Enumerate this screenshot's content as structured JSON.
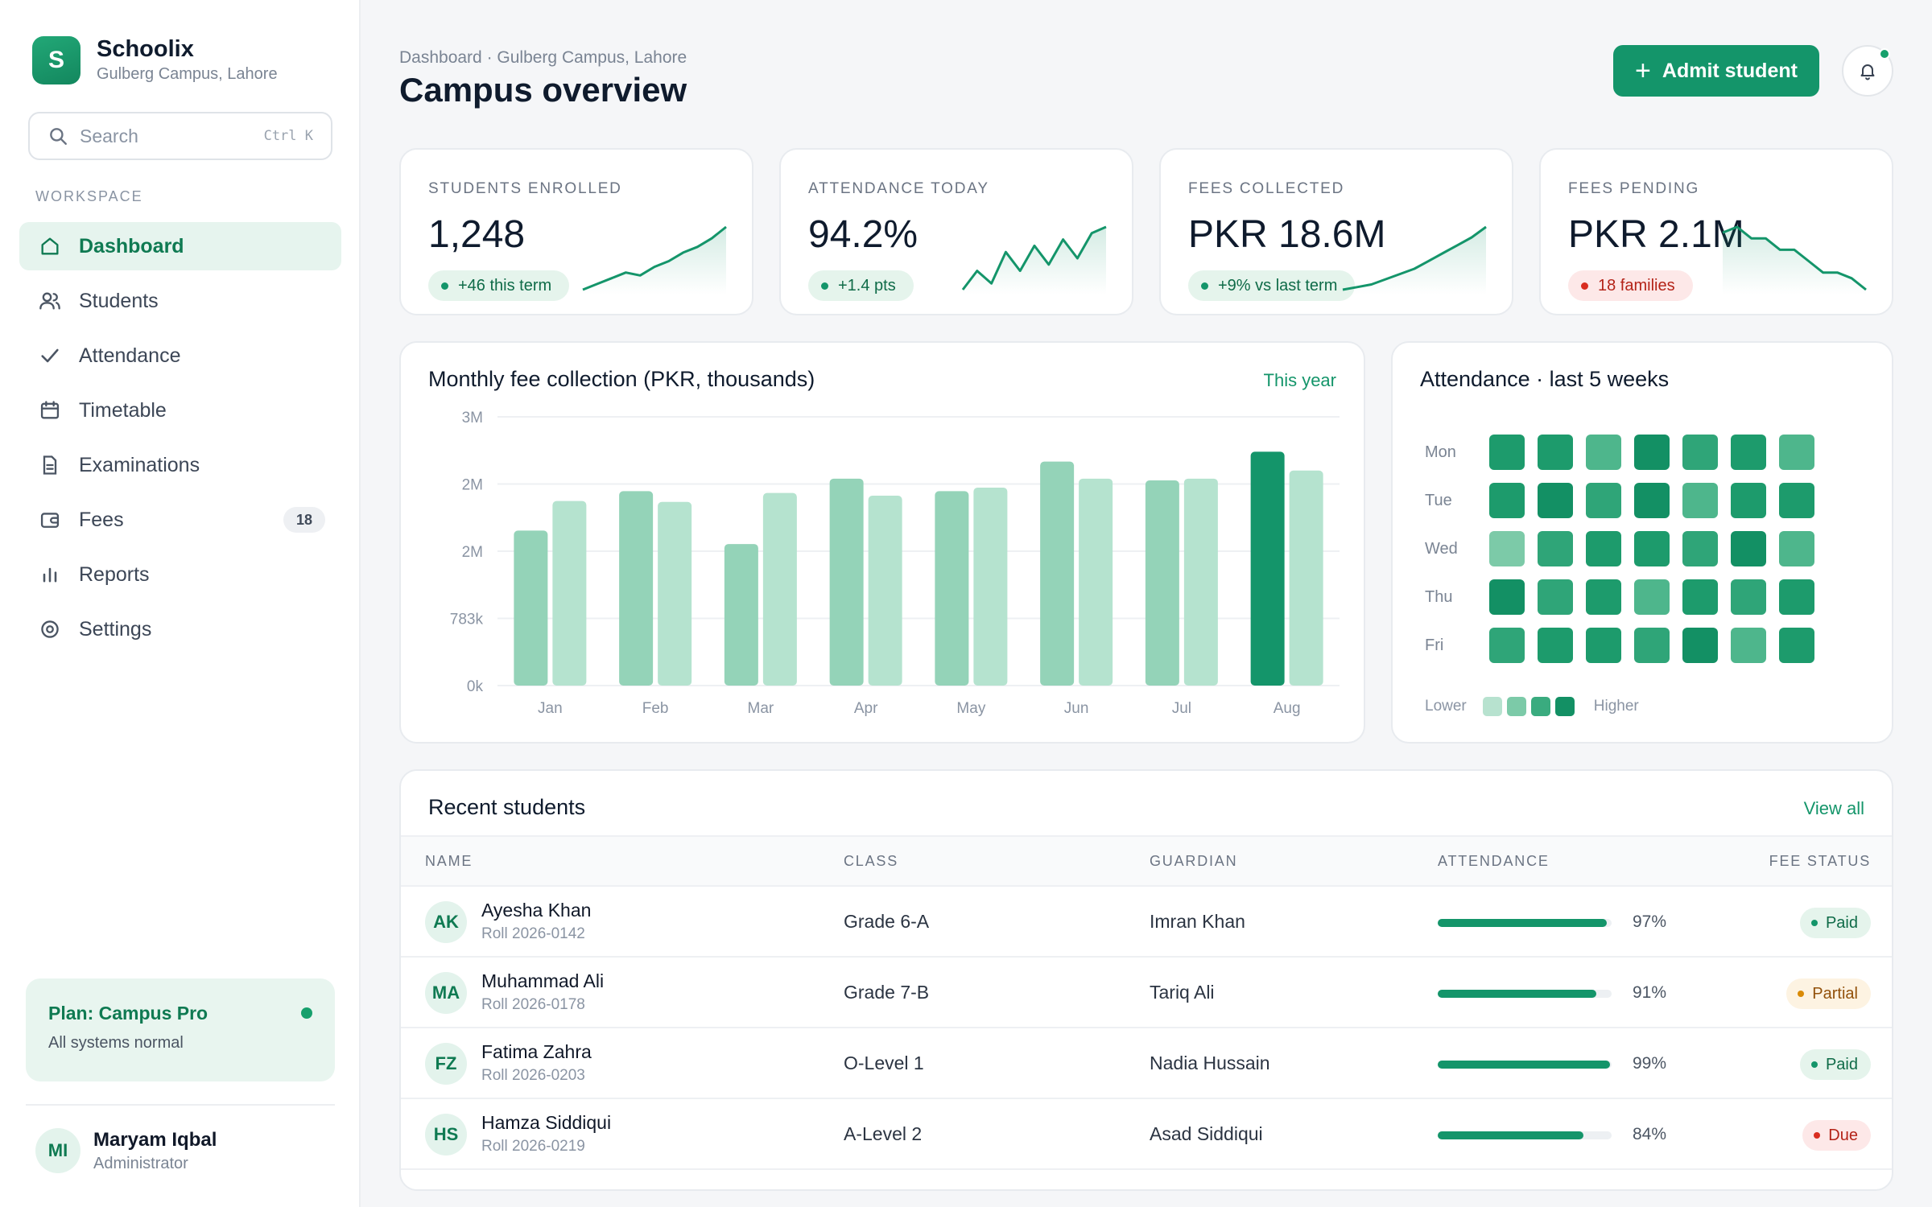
{
  "app": {
    "name": "Schoolix",
    "campus": "Gulberg Campus, Lahore",
    "logo_letter": "S"
  },
  "search": {
    "placeholder": "Search",
    "shortcut": "Ctrl K"
  },
  "sidebar": {
    "section_label": "WORKSPACE",
    "items": [
      {
        "label": "Dashboard",
        "icon": "home-icon",
        "active": true
      },
      {
        "label": "Students",
        "icon": "users-icon"
      },
      {
        "label": "Attendance",
        "icon": "check-icon"
      },
      {
        "label": "Timetable",
        "icon": "calendar-icon"
      },
      {
        "label": "Examinations",
        "icon": "document-icon"
      },
      {
        "label": "Fees",
        "icon": "wallet-icon",
        "badge": "18"
      },
      {
        "label": "Reports",
        "icon": "bar-chart-icon"
      },
      {
        "label": "Settings",
        "icon": "gear-icon"
      }
    ],
    "plan": {
      "title": "Plan: Campus Pro",
      "status": "All systems normal"
    },
    "user": {
      "initials": "MI",
      "name": "Maryam Iqbal",
      "role": "Administrator"
    }
  },
  "header": {
    "breadcrumb": "Dashboard · Gulberg Campus, Lahore",
    "title": "Campus overview",
    "admit_label": "Admit student"
  },
  "kpis": [
    {
      "label": "STUDENTS ENROLLED",
      "value": "1,248",
      "delta": "+46 this term",
      "tone": "good",
      "trend": [
        2,
        3,
        4,
        5,
        4.5,
        6,
        7,
        8.5,
        9.5,
        11,
        13
      ]
    },
    {
      "label": "ATTENDANCE TODAY",
      "value": "94.2%",
      "delta": "+1.4 pts",
      "tone": "good",
      "trend": [
        3,
        6,
        4,
        9,
        6,
        10,
        7,
        11,
        8,
        12,
        13
      ]
    },
    {
      "label": "FEES COLLECTED",
      "value": "PKR 18.6M",
      "delta": "+9% vs last term",
      "tone": "good",
      "trend": [
        1,
        1.5,
        2,
        3,
        4,
        5,
        6.5,
        8,
        9.5,
        11,
        13
      ]
    },
    {
      "label": "FEES PENDING",
      "value": "PKR 2.1M",
      "delta": "18 families",
      "tone": "bad",
      "trend": [
        12,
        13,
        11,
        11,
        9,
        9,
        7,
        5,
        5,
        4,
        2
      ]
    }
  ],
  "colors": {
    "accent": "#14956a",
    "accent_light": "#e6f4ee",
    "danger": "#d92d20",
    "warning": "#d98a06"
  },
  "chart_data": {
    "type": "bar",
    "title": "Monthly fee collection (PKR, thousands)",
    "period_link": "This year",
    "categories": [
      "Jan",
      "Feb",
      "Mar",
      "Apr",
      "May",
      "Jun",
      "Jul",
      "Aug"
    ],
    "yticks": [
      "0k",
      "783k",
      "2M",
      "2M",
      "3M"
    ],
    "ylim": [
      0,
      3000
    ],
    "series": [
      {
        "values": [
          1730,
          2170,
          1580,
          2310,
          2170,
          2500,
          2290,
          2610
        ]
      },
      {
        "values": [
          2060,
          2050,
          2150,
          2120,
          2210,
          2310,
          2310,
          2400
        ]
      }
    ],
    "highlight_index": 7,
    "grid": true
  },
  "heatmap": {
    "title": "Attendance · last 5 weeks",
    "days": [
      "Mon",
      "Tue",
      "Wed",
      "Thu",
      "Fri"
    ],
    "levels": [
      [
        3,
        3,
        1,
        4,
        2,
        3,
        1
      ],
      [
        3,
        4,
        2,
        4,
        1,
        3,
        3
      ],
      [
        0,
        2,
        3,
        3,
        2,
        4,
        1
      ],
      [
        4,
        2,
        3,
        1,
        3,
        2,
        3
      ],
      [
        2,
        3,
        3,
        2,
        4,
        1,
        3
      ]
    ],
    "level_colors": [
      "#7ccaa8",
      "#4eb68c",
      "#2fa578",
      "#1d9b6c",
      "#139064"
    ],
    "legend_low": "Lower",
    "legend_high": "Higher"
  },
  "students": {
    "title": "Recent students",
    "view_all": "View all",
    "columns": [
      "NAME",
      "CLASS",
      "GUARDIAN",
      "ATTENDANCE",
      "FEE STATUS"
    ],
    "rows": [
      {
        "initials": "AK",
        "name": "Ayesha Khan",
        "roll": "Roll 2026-0142",
        "class": "Grade 6-A",
        "guardian": "Imran Khan",
        "attendance": 97,
        "attendance_label": "97%",
        "fee_status": "Paid",
        "fee_tone": "paid"
      },
      {
        "initials": "MA",
        "name": "Muhammad Ali",
        "roll": "Roll 2026-0178",
        "class": "Grade 7-B",
        "guardian": "Tariq Ali",
        "attendance": 91,
        "attendance_label": "91%",
        "fee_status": "Partial",
        "fee_tone": "partial"
      },
      {
        "initials": "FZ",
        "name": "Fatima Zahra",
        "roll": "Roll 2026-0203",
        "class": "O-Level 1",
        "guardian": "Nadia Hussain",
        "attendance": 99,
        "attendance_label": "99%",
        "fee_status": "Paid",
        "fee_tone": "paid"
      },
      {
        "initials": "HS",
        "name": "Hamza Siddiqui",
        "roll": "Roll 2026-0219",
        "class": "A-Level 2",
        "guardian": "Asad Siddiqui",
        "attendance": 84,
        "attendance_label": "84%",
        "fee_status": "Due",
        "fee_tone": "due"
      }
    ]
  }
}
